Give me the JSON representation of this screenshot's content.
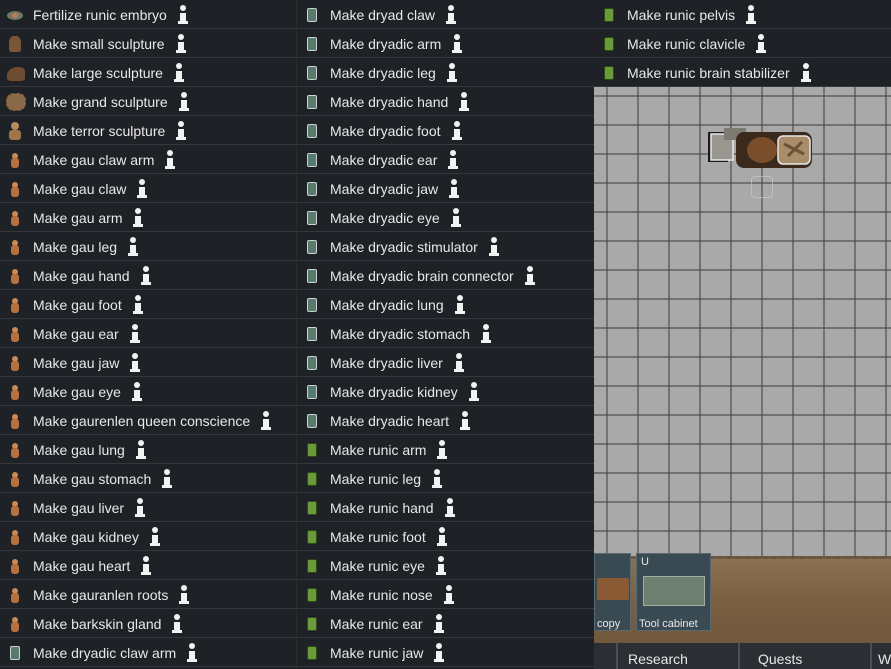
{
  "menu": {
    "col1": [
      {
        "label": "Fertilize runic embryo",
        "icon": "embryo-icon"
      },
      {
        "label": "Make small sculpture",
        "icon": "small-sculpture-icon"
      },
      {
        "label": "Make large sculpture",
        "icon": "large-sculpture-icon"
      },
      {
        "label": "Make grand sculpture",
        "icon": "grand-sculpture-icon"
      },
      {
        "label": "Make terror sculpture",
        "icon": "terror-sculpture-icon"
      },
      {
        "label": "Make gau claw arm",
        "icon": "gau-icon"
      },
      {
        "label": "Make gau claw",
        "icon": "gau-icon"
      },
      {
        "label": "Make gau arm",
        "icon": "gau-icon"
      },
      {
        "label": "Make gau leg",
        "icon": "gau-icon"
      },
      {
        "label": "Make gau hand",
        "icon": "gau-icon"
      },
      {
        "label": "Make gau foot",
        "icon": "gau-icon"
      },
      {
        "label": "Make gau ear",
        "icon": "gau-icon"
      },
      {
        "label": "Make gau jaw",
        "icon": "gau-icon"
      },
      {
        "label": "Make gau eye",
        "icon": "gau-icon"
      },
      {
        "label": "Make gaurenlen queen conscience",
        "icon": "gau-icon"
      },
      {
        "label": "Make gau lung",
        "icon": "gau-icon"
      },
      {
        "label": "Make gau stomach",
        "icon": "gau-icon"
      },
      {
        "label": "Make gau liver",
        "icon": "gau-icon"
      },
      {
        "label": "Make gau kidney",
        "icon": "gau-icon"
      },
      {
        "label": "Make gau heart",
        "icon": "gau-icon"
      },
      {
        "label": "Make gauranlen roots",
        "icon": "gau-icon"
      },
      {
        "label": "Make barkskin gland",
        "icon": "gau-icon"
      },
      {
        "label": "Make dryadic claw arm",
        "icon": "dryad-icon"
      }
    ],
    "col2": [
      {
        "label": "Make dryad claw",
        "icon": "dryad-icon"
      },
      {
        "label": "Make dryadic arm",
        "icon": "dryad-icon"
      },
      {
        "label": "Make dryadic leg",
        "icon": "dryad-icon"
      },
      {
        "label": "Make dryadic hand",
        "icon": "dryad-icon"
      },
      {
        "label": "Make dryadic foot",
        "icon": "dryad-icon"
      },
      {
        "label": "Make dryadic ear",
        "icon": "dryad-icon"
      },
      {
        "label": "Make dryadic jaw",
        "icon": "dryad-icon"
      },
      {
        "label": "Make dryadic eye",
        "icon": "dryad-icon"
      },
      {
        "label": "Make dryadic stimulator",
        "icon": "dryad-icon"
      },
      {
        "label": "Make dryadic brain connector",
        "icon": "dryad-icon"
      },
      {
        "label": "Make dryadic lung",
        "icon": "dryad-icon"
      },
      {
        "label": "Make dryadic stomach",
        "icon": "dryad-icon"
      },
      {
        "label": "Make dryadic liver",
        "icon": "dryad-icon"
      },
      {
        "label": "Make dryadic kidney",
        "icon": "dryad-icon"
      },
      {
        "label": "Make dryadic heart",
        "icon": "dryad-icon"
      },
      {
        "label": "Make runic arm",
        "icon": "runic-icon"
      },
      {
        "label": "Make runic leg",
        "icon": "runic-icon"
      },
      {
        "label": "Make runic hand",
        "icon": "runic-icon"
      },
      {
        "label": "Make runic foot",
        "icon": "runic-icon"
      },
      {
        "label": "Make runic eye",
        "icon": "runic-icon"
      },
      {
        "label": "Make runic nose",
        "icon": "runic-icon"
      },
      {
        "label": "Make runic ear",
        "icon": "runic-icon"
      },
      {
        "label": "Make runic jaw",
        "icon": "runic-icon"
      }
    ],
    "col3": [
      {
        "label": "Make runic pelvis",
        "icon": "runic-icon"
      },
      {
        "label": "Make runic clavicle",
        "icon": "runic-icon"
      },
      {
        "label": "Make runic brain stabilizer",
        "icon": "runic-icon"
      }
    ]
  },
  "cards": {
    "left_caption": "copy",
    "tool_cabinet_caption": "Tool cabinet",
    "tool_cabinet_hotkey": "U"
  },
  "tabs": {
    "research": "Research",
    "quests": "Quests",
    "partial": "W"
  },
  "colors": {
    "menu_bg": "#1e2126",
    "map_floor": "#a9a9a9",
    "dirt": "#7a5f42"
  }
}
